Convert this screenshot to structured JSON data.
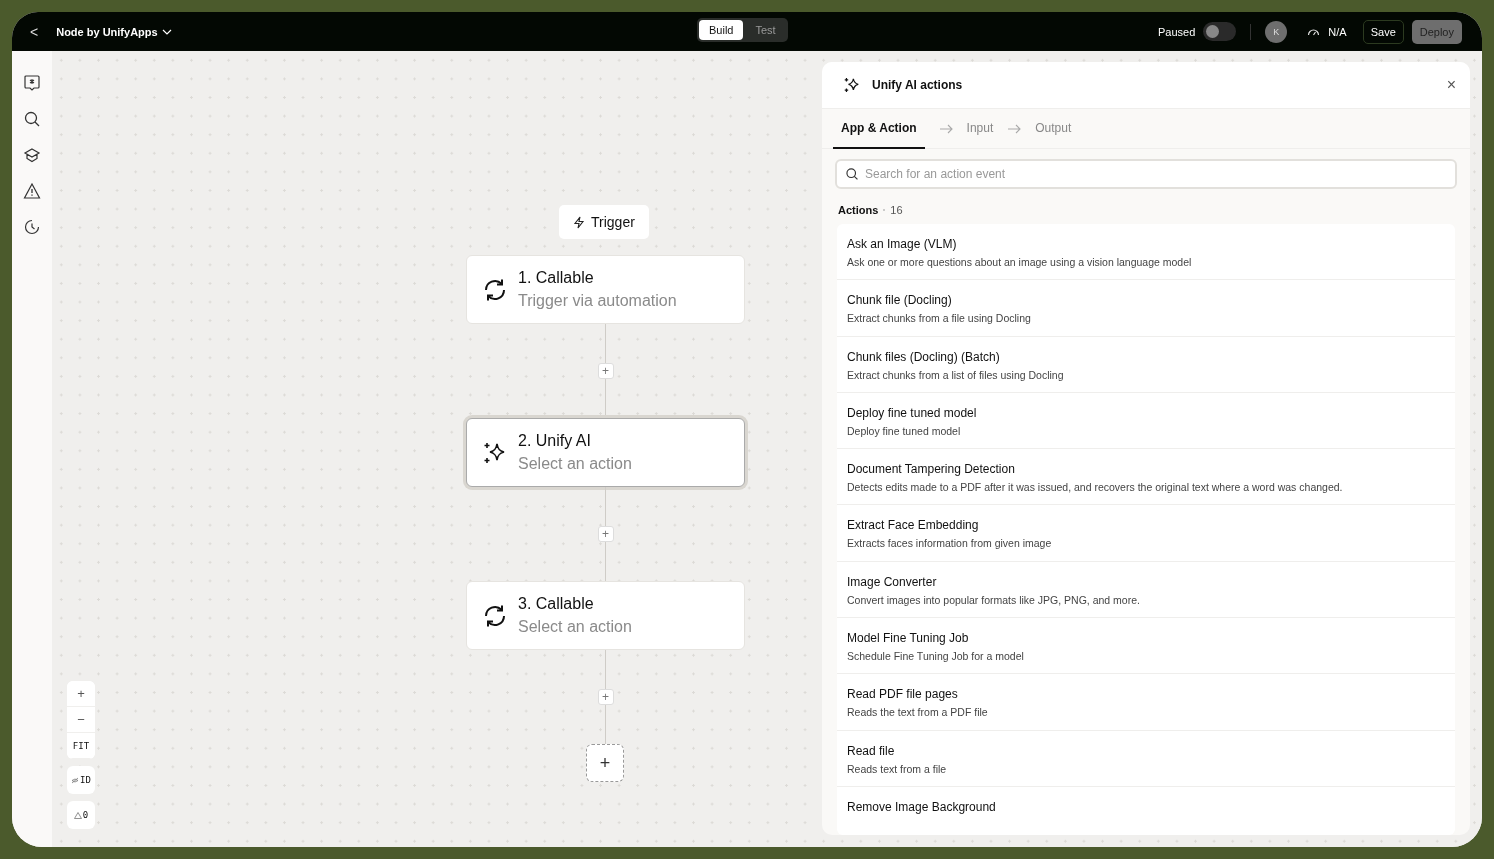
{
  "topbar": {
    "back": "<",
    "title": "Node by UnifyApps",
    "mode_tabs": [
      {
        "label": "Build",
        "selected": true
      },
      {
        "label": "Test",
        "selected": false
      }
    ],
    "toggle": {
      "label": "Paused",
      "on": false
    },
    "avatar": "K",
    "status": "N/A",
    "save": "Save",
    "deploy": "Deploy"
  },
  "sidebar": {
    "items": [
      {
        "kind": "assistant"
      },
      {
        "kind": "search"
      },
      {
        "kind": "learn"
      },
      {
        "kind": "warning"
      },
      {
        "kind": "history"
      }
    ]
  },
  "canvas": {
    "trigger": "Trigger",
    "nodes": [
      {
        "title": "1. Callable",
        "subtitle": "Trigger via automation",
        "kind": "callable",
        "selected": false
      },
      {
        "title": "2. Unify AI",
        "subtitle": "Select an action",
        "kind": "ai",
        "selected": true
      },
      {
        "title": "3. Callable",
        "subtitle": "Select an action",
        "kind": "callable",
        "selected": false
      }
    ],
    "add": "+",
    "controls": {
      "zoom_in": "+",
      "zoom_out": "−",
      "fit": "FIT",
      "ids": "ID",
      "warnings": "0"
    }
  },
  "panel": {
    "title": "Unify AI actions",
    "close": "×",
    "steps": [
      {
        "label": "App & Action",
        "selected": true
      },
      {
        "label": "Input",
        "selected": false
      },
      {
        "label": "Output",
        "selected": false
      }
    ],
    "search": {
      "placeholder": "Search for an action event"
    },
    "section": "Actions",
    "count": "16",
    "actions": [
      {
        "name": "Ask an Image (VLM)",
        "description": "Ask one or more questions about an image using a vision language model"
      },
      {
        "name": "Chunk file (Docling)",
        "description": "Extract chunks from a file using Docling"
      },
      {
        "name": "Chunk files (Docling) (Batch)",
        "description": "Extract chunks from a list of files using Docling"
      },
      {
        "name": "Deploy fine tuned model",
        "description": "Deploy fine tuned model"
      },
      {
        "name": "Document Tampering Detection",
        "description": "Detects edits made to a PDF after it was issued, and recovers the original text where a word was changed."
      },
      {
        "name": "Extract Face Embedding",
        "description": "Extracts faces information from given image"
      },
      {
        "name": "Image Converter",
        "description": "Convert images into popular formats like JPG, PNG, and more."
      },
      {
        "name": "Model Fine Tuning Job",
        "description": "Schedule Fine Tuning Job for a model"
      },
      {
        "name": "Read PDF file pages",
        "description": "Reads the text from a PDF file"
      },
      {
        "name": "Read file",
        "description": "Reads text from a file"
      },
      {
        "name": "Remove Image Background"
      }
    ]
  }
}
